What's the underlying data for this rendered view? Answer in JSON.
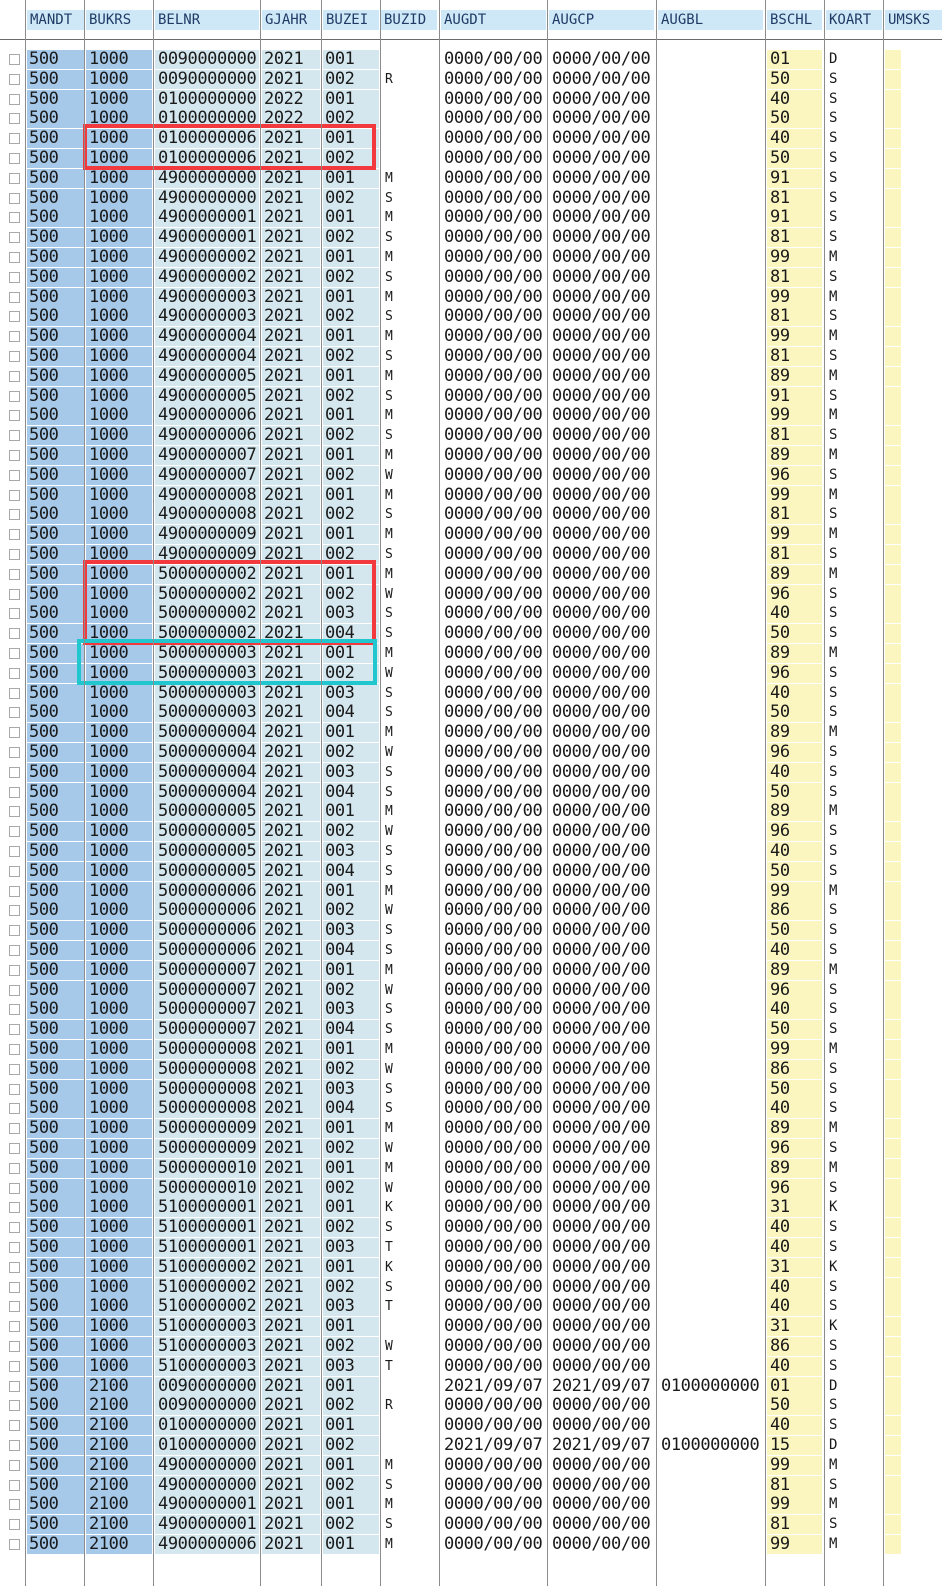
{
  "columns": [
    {
      "key": "mandt",
      "label": "MANDT"
    },
    {
      "key": "bukrs",
      "label": "BUKRS"
    },
    {
      "key": "belnr",
      "label": "BELNR"
    },
    {
      "key": "gjahr",
      "label": "GJAHR"
    },
    {
      "key": "buzei",
      "label": "BUZEI"
    },
    {
      "key": "buzid",
      "label": "BUZID"
    },
    {
      "key": "augdt",
      "label": "AUGDT"
    },
    {
      "key": "augcp",
      "label": "AUGCP"
    },
    {
      "key": "augbl",
      "label": "AUGBL"
    },
    {
      "key": "bschl",
      "label": "BSCHL"
    },
    {
      "key": "koart",
      "label": "KOART"
    },
    {
      "key": "umsk",
      "label": "UMSKS"
    }
  ],
  "rows": [
    [
      "500",
      "1000",
      "0090000000",
      "2021",
      "001",
      "",
      "0000/00/00",
      "0000/00/00",
      "",
      "01",
      "D"
    ],
    [
      "500",
      "1000",
      "0090000000",
      "2021",
      "002",
      "R",
      "0000/00/00",
      "0000/00/00",
      "",
      "50",
      "S"
    ],
    [
      "500",
      "1000",
      "0100000000",
      "2022",
      "001",
      "",
      "0000/00/00",
      "0000/00/00",
      "",
      "40",
      "S"
    ],
    [
      "500",
      "1000",
      "0100000000",
      "2022",
      "002",
      "",
      "0000/00/00",
      "0000/00/00",
      "",
      "50",
      "S"
    ],
    [
      "500",
      "1000",
      "0100000006",
      "2021",
      "001",
      "",
      "0000/00/00",
      "0000/00/00",
      "",
      "40",
      "S"
    ],
    [
      "500",
      "1000",
      "0100000006",
      "2021",
      "002",
      "",
      "0000/00/00",
      "0000/00/00",
      "",
      "50",
      "S"
    ],
    [
      "500",
      "1000",
      "4900000000",
      "2021",
      "001",
      "M",
      "0000/00/00",
      "0000/00/00",
      "",
      "91",
      "S"
    ],
    [
      "500",
      "1000",
      "4900000000",
      "2021",
      "002",
      "S",
      "0000/00/00",
      "0000/00/00",
      "",
      "81",
      "S"
    ],
    [
      "500",
      "1000",
      "4900000001",
      "2021",
      "001",
      "M",
      "0000/00/00",
      "0000/00/00",
      "",
      "91",
      "S"
    ],
    [
      "500",
      "1000",
      "4900000001",
      "2021",
      "002",
      "S",
      "0000/00/00",
      "0000/00/00",
      "",
      "81",
      "S"
    ],
    [
      "500",
      "1000",
      "4900000002",
      "2021",
      "001",
      "M",
      "0000/00/00",
      "0000/00/00",
      "",
      "99",
      "M"
    ],
    [
      "500",
      "1000",
      "4900000002",
      "2021",
      "002",
      "S",
      "0000/00/00",
      "0000/00/00",
      "",
      "81",
      "S"
    ],
    [
      "500",
      "1000",
      "4900000003",
      "2021",
      "001",
      "M",
      "0000/00/00",
      "0000/00/00",
      "",
      "99",
      "M"
    ],
    [
      "500",
      "1000",
      "4900000003",
      "2021",
      "002",
      "S",
      "0000/00/00",
      "0000/00/00",
      "",
      "81",
      "S"
    ],
    [
      "500",
      "1000",
      "4900000004",
      "2021",
      "001",
      "M",
      "0000/00/00",
      "0000/00/00",
      "",
      "99",
      "M"
    ],
    [
      "500",
      "1000",
      "4900000004",
      "2021",
      "002",
      "S",
      "0000/00/00",
      "0000/00/00",
      "",
      "81",
      "S"
    ],
    [
      "500",
      "1000",
      "4900000005",
      "2021",
      "001",
      "M",
      "0000/00/00",
      "0000/00/00",
      "",
      "89",
      "M"
    ],
    [
      "500",
      "1000",
      "4900000005",
      "2021",
      "002",
      "S",
      "0000/00/00",
      "0000/00/00",
      "",
      "91",
      "S"
    ],
    [
      "500",
      "1000",
      "4900000006",
      "2021",
      "001",
      "M",
      "0000/00/00",
      "0000/00/00",
      "",
      "99",
      "M"
    ],
    [
      "500",
      "1000",
      "4900000006",
      "2021",
      "002",
      "S",
      "0000/00/00",
      "0000/00/00",
      "",
      "81",
      "S"
    ],
    [
      "500",
      "1000",
      "4900000007",
      "2021",
      "001",
      "M",
      "0000/00/00",
      "0000/00/00",
      "",
      "89",
      "M"
    ],
    [
      "500",
      "1000",
      "4900000007",
      "2021",
      "002",
      "W",
      "0000/00/00",
      "0000/00/00",
      "",
      "96",
      "S"
    ],
    [
      "500",
      "1000",
      "4900000008",
      "2021",
      "001",
      "M",
      "0000/00/00",
      "0000/00/00",
      "",
      "99",
      "M"
    ],
    [
      "500",
      "1000",
      "4900000008",
      "2021",
      "002",
      "S",
      "0000/00/00",
      "0000/00/00",
      "",
      "81",
      "S"
    ],
    [
      "500",
      "1000",
      "4900000009",
      "2021",
      "001",
      "M",
      "0000/00/00",
      "0000/00/00",
      "",
      "99",
      "M"
    ],
    [
      "500",
      "1000",
      "4900000009",
      "2021",
      "002",
      "S",
      "0000/00/00",
      "0000/00/00",
      "",
      "81",
      "S"
    ],
    [
      "500",
      "1000",
      "5000000002",
      "2021",
      "001",
      "M",
      "0000/00/00",
      "0000/00/00",
      "",
      "89",
      "M"
    ],
    [
      "500",
      "1000",
      "5000000002",
      "2021",
      "002",
      "W",
      "0000/00/00",
      "0000/00/00",
      "",
      "96",
      "S"
    ],
    [
      "500",
      "1000",
      "5000000002",
      "2021",
      "003",
      "S",
      "0000/00/00",
      "0000/00/00",
      "",
      "40",
      "S"
    ],
    [
      "500",
      "1000",
      "5000000002",
      "2021",
      "004",
      "S",
      "0000/00/00",
      "0000/00/00",
      "",
      "50",
      "S"
    ],
    [
      "500",
      "1000",
      "5000000003",
      "2021",
      "001",
      "M",
      "0000/00/00",
      "0000/00/00",
      "",
      "89",
      "M"
    ],
    [
      "500",
      "1000",
      "5000000003",
      "2021",
      "002",
      "W",
      "0000/00/00",
      "0000/00/00",
      "",
      "96",
      "S"
    ],
    [
      "500",
      "1000",
      "5000000003",
      "2021",
      "003",
      "S",
      "0000/00/00",
      "0000/00/00",
      "",
      "40",
      "S"
    ],
    [
      "500",
      "1000",
      "5000000003",
      "2021",
      "004",
      "S",
      "0000/00/00",
      "0000/00/00",
      "",
      "50",
      "S"
    ],
    [
      "500",
      "1000",
      "5000000004",
      "2021",
      "001",
      "M",
      "0000/00/00",
      "0000/00/00",
      "",
      "89",
      "M"
    ],
    [
      "500",
      "1000",
      "5000000004",
      "2021",
      "002",
      "W",
      "0000/00/00",
      "0000/00/00",
      "",
      "96",
      "S"
    ],
    [
      "500",
      "1000",
      "5000000004",
      "2021",
      "003",
      "S",
      "0000/00/00",
      "0000/00/00",
      "",
      "40",
      "S"
    ],
    [
      "500",
      "1000",
      "5000000004",
      "2021",
      "004",
      "S",
      "0000/00/00",
      "0000/00/00",
      "",
      "50",
      "S"
    ],
    [
      "500",
      "1000",
      "5000000005",
      "2021",
      "001",
      "M",
      "0000/00/00",
      "0000/00/00",
      "",
      "89",
      "M"
    ],
    [
      "500",
      "1000",
      "5000000005",
      "2021",
      "002",
      "W",
      "0000/00/00",
      "0000/00/00",
      "",
      "96",
      "S"
    ],
    [
      "500",
      "1000",
      "5000000005",
      "2021",
      "003",
      "S",
      "0000/00/00",
      "0000/00/00",
      "",
      "40",
      "S"
    ],
    [
      "500",
      "1000",
      "5000000005",
      "2021",
      "004",
      "S",
      "0000/00/00",
      "0000/00/00",
      "",
      "50",
      "S"
    ],
    [
      "500",
      "1000",
      "5000000006",
      "2021",
      "001",
      "M",
      "0000/00/00",
      "0000/00/00",
      "",
      "99",
      "M"
    ],
    [
      "500",
      "1000",
      "5000000006",
      "2021",
      "002",
      "W",
      "0000/00/00",
      "0000/00/00",
      "",
      "86",
      "S"
    ],
    [
      "500",
      "1000",
      "5000000006",
      "2021",
      "003",
      "S",
      "0000/00/00",
      "0000/00/00",
      "",
      "50",
      "S"
    ],
    [
      "500",
      "1000",
      "5000000006",
      "2021",
      "004",
      "S",
      "0000/00/00",
      "0000/00/00",
      "",
      "40",
      "S"
    ],
    [
      "500",
      "1000",
      "5000000007",
      "2021",
      "001",
      "M",
      "0000/00/00",
      "0000/00/00",
      "",
      "89",
      "M"
    ],
    [
      "500",
      "1000",
      "5000000007",
      "2021",
      "002",
      "W",
      "0000/00/00",
      "0000/00/00",
      "",
      "96",
      "S"
    ],
    [
      "500",
      "1000",
      "5000000007",
      "2021",
      "003",
      "S",
      "0000/00/00",
      "0000/00/00",
      "",
      "40",
      "S"
    ],
    [
      "500",
      "1000",
      "5000000007",
      "2021",
      "004",
      "S",
      "0000/00/00",
      "0000/00/00",
      "",
      "50",
      "S"
    ],
    [
      "500",
      "1000",
      "5000000008",
      "2021",
      "001",
      "M",
      "0000/00/00",
      "0000/00/00",
      "",
      "99",
      "M"
    ],
    [
      "500",
      "1000",
      "5000000008",
      "2021",
      "002",
      "W",
      "0000/00/00",
      "0000/00/00",
      "",
      "86",
      "S"
    ],
    [
      "500",
      "1000",
      "5000000008",
      "2021",
      "003",
      "S",
      "0000/00/00",
      "0000/00/00",
      "",
      "50",
      "S"
    ],
    [
      "500",
      "1000",
      "5000000008",
      "2021",
      "004",
      "S",
      "0000/00/00",
      "0000/00/00",
      "",
      "40",
      "S"
    ],
    [
      "500",
      "1000",
      "5000000009",
      "2021",
      "001",
      "M",
      "0000/00/00",
      "0000/00/00",
      "",
      "89",
      "M"
    ],
    [
      "500",
      "1000",
      "5000000009",
      "2021",
      "002",
      "W",
      "0000/00/00",
      "0000/00/00",
      "",
      "96",
      "S"
    ],
    [
      "500",
      "1000",
      "5000000010",
      "2021",
      "001",
      "M",
      "0000/00/00",
      "0000/00/00",
      "",
      "89",
      "M"
    ],
    [
      "500",
      "1000",
      "5000000010",
      "2021",
      "002",
      "W",
      "0000/00/00",
      "0000/00/00",
      "",
      "96",
      "S"
    ],
    [
      "500",
      "1000",
      "5100000001",
      "2021",
      "001",
      "K",
      "0000/00/00",
      "0000/00/00",
      "",
      "31",
      "K"
    ],
    [
      "500",
      "1000",
      "5100000001",
      "2021",
      "002",
      "S",
      "0000/00/00",
      "0000/00/00",
      "",
      "40",
      "S"
    ],
    [
      "500",
      "1000",
      "5100000001",
      "2021",
      "003",
      "T",
      "0000/00/00",
      "0000/00/00",
      "",
      "40",
      "S"
    ],
    [
      "500",
      "1000",
      "5100000002",
      "2021",
      "001",
      "K",
      "0000/00/00",
      "0000/00/00",
      "",
      "31",
      "K"
    ],
    [
      "500",
      "1000",
      "5100000002",
      "2021",
      "002",
      "S",
      "0000/00/00",
      "0000/00/00",
      "",
      "40",
      "S"
    ],
    [
      "500",
      "1000",
      "5100000002",
      "2021",
      "003",
      "T",
      "0000/00/00",
      "0000/00/00",
      "",
      "40",
      "S"
    ],
    [
      "500",
      "1000",
      "5100000003",
      "2021",
      "001",
      "",
      "0000/00/00",
      "0000/00/00",
      "",
      "31",
      "K"
    ],
    [
      "500",
      "1000",
      "5100000003",
      "2021",
      "002",
      "W",
      "0000/00/00",
      "0000/00/00",
      "",
      "86",
      "S"
    ],
    [
      "500",
      "1000",
      "5100000003",
      "2021",
      "003",
      "T",
      "0000/00/00",
      "0000/00/00",
      "",
      "40",
      "S"
    ],
    [
      "500",
      "2100",
      "0090000000",
      "2021",
      "001",
      "",
      "2021/09/07",
      "2021/09/07",
      "0100000000",
      "01",
      "D"
    ],
    [
      "500",
      "2100",
      "0090000000",
      "2021",
      "002",
      "R",
      "0000/00/00",
      "0000/00/00",
      "",
      "50",
      "S"
    ],
    [
      "500",
      "2100",
      "0100000000",
      "2021",
      "001",
      "",
      "0000/00/00",
      "0000/00/00",
      "",
      "40",
      "S"
    ],
    [
      "500",
      "2100",
      "0100000000",
      "2021",
      "002",
      "",
      "2021/09/07",
      "2021/09/07",
      "0100000000",
      "15",
      "D"
    ],
    [
      "500",
      "2100",
      "4900000000",
      "2021",
      "001",
      "M",
      "0000/00/00",
      "0000/00/00",
      "",
      "99",
      "M"
    ],
    [
      "500",
      "2100",
      "4900000000",
      "2021",
      "002",
      "S",
      "0000/00/00",
      "0000/00/00",
      "",
      "81",
      "S"
    ],
    [
      "500",
      "2100",
      "4900000001",
      "2021",
      "001",
      "M",
      "0000/00/00",
      "0000/00/00",
      "",
      "99",
      "M"
    ],
    [
      "500",
      "2100",
      "4900000001",
      "2021",
      "002",
      "S",
      "0000/00/00",
      "0000/00/00",
      "",
      "81",
      "S"
    ],
    [
      "500",
      "2100",
      "4900000006",
      "2021",
      "001",
      "M",
      "0000/00/00",
      "0000/00/00",
      "",
      "99",
      "M"
    ]
  ],
  "highlights": [
    {
      "name": "highlight-box-0100000006",
      "color": "#f2393e",
      "from_row": 4,
      "to_row": 5
    },
    {
      "name": "highlight-box-5000000002",
      "color": "#f2393e",
      "from_row": 26,
      "to_row": 29
    },
    {
      "name": "highlight-box-5000000003",
      "color": "#21c7cf",
      "from_row": 30,
      "to_row": 31
    }
  ]
}
